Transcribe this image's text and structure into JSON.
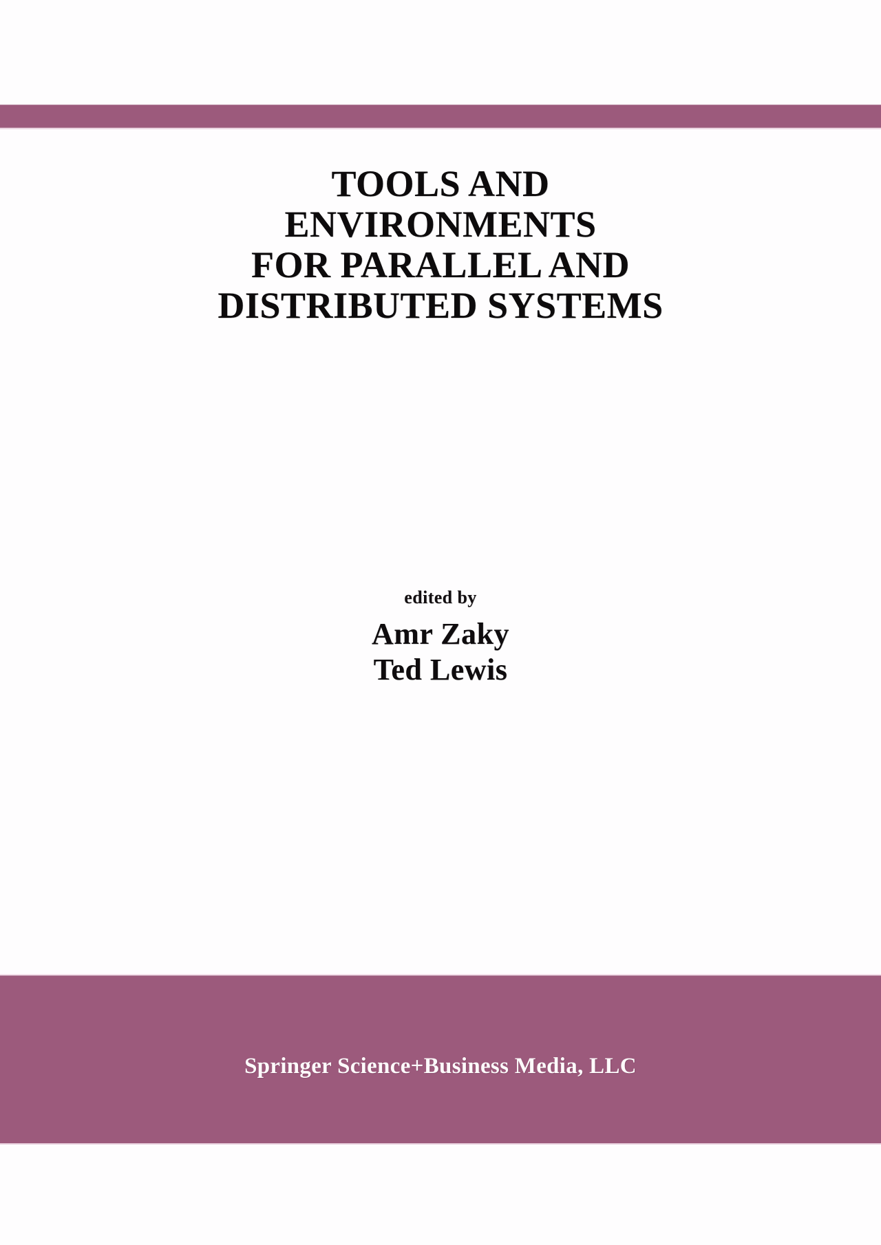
{
  "cover": {
    "accent_color": "#9c5a7c",
    "background_color": "#ffffff",
    "text_color": "#0d0b0c",
    "publisher_text_color": "#fdfafb"
  },
  "title": {
    "lines": [
      "TOOLS AND",
      "ENVIRONMENTS",
      "FOR PARALLEL AND",
      "DISTRIBUTED SYSTEMS"
    ],
    "full": "TOOLS AND ENVIRONMENTS FOR PARALLEL AND DISTRIBUTED SYSTEMS"
  },
  "editors": {
    "label": "edited by",
    "names": [
      "Amr Zaky",
      "Ted Lewis"
    ]
  },
  "publisher": {
    "name": "Springer Science+Business Media, LLC"
  }
}
